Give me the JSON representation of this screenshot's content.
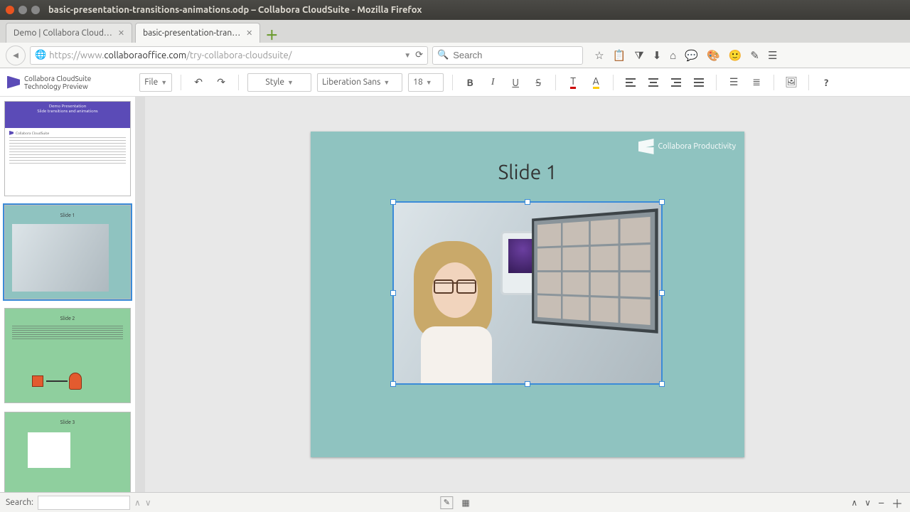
{
  "window": {
    "title": "basic-presentation-transitions-animations.odp – Collabora CloudSuite - Mozilla Firefox"
  },
  "tabs": {
    "t0": "Demo | Collabora Cloud…",
    "t1": "basic-presentation-tran…"
  },
  "url": {
    "pre": "https://www.",
    "strong": "collaboraoffice.com",
    "post": "/try-collabora-cloudsuite/"
  },
  "search": {
    "placeholder": "Search"
  },
  "brand": {
    "line1": "Collabora CloudSuite",
    "line2": "Technology Preview"
  },
  "toolbar": {
    "file": "File",
    "style": "Style",
    "font": "Liberation Sans",
    "size": "18",
    "help": "?"
  },
  "slide": {
    "title": "Slide 1",
    "corner": "Collabora Productivity"
  },
  "thumbs": {
    "s1_title1": "Demo Presentation",
    "s1_title2": "Slide transitions and animations",
    "s1_brand": "Collabora CloudSuite",
    "s2": "Slide 1",
    "s3": "Slide 2",
    "s4": "Slide 3"
  },
  "status": {
    "search": "Search:"
  }
}
